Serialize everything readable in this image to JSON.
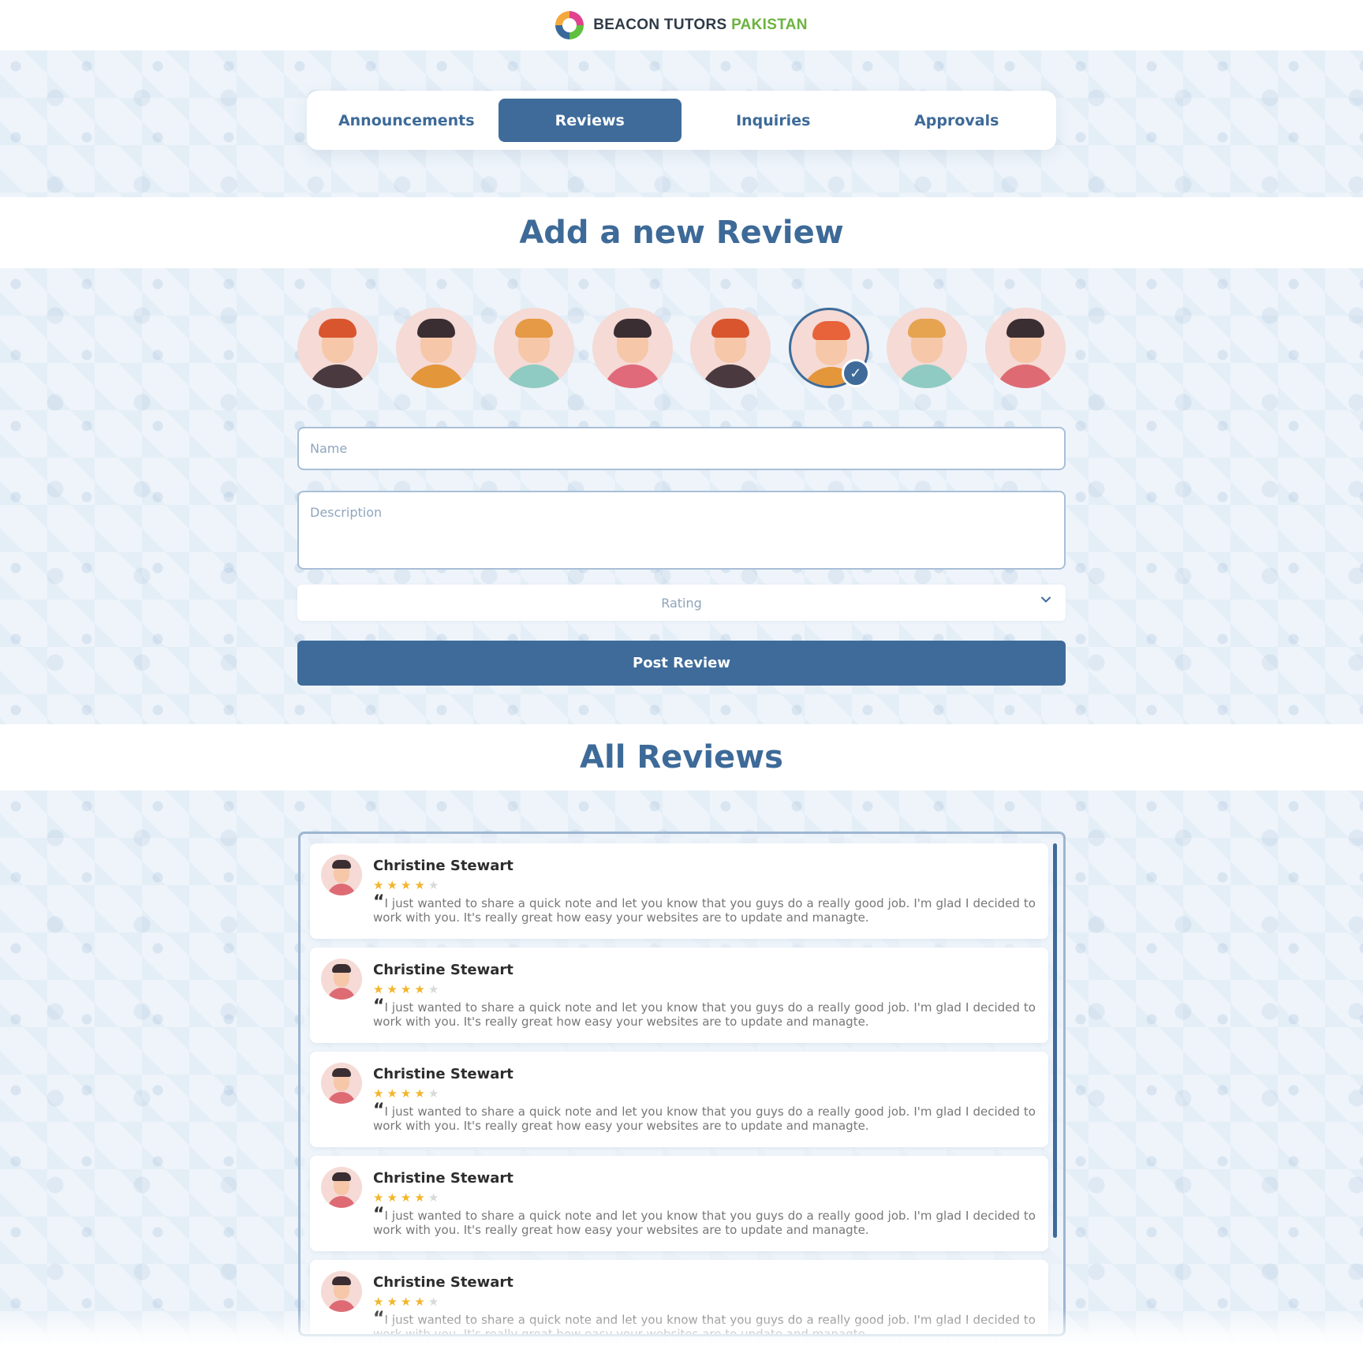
{
  "header": {
    "brand_main": "BEACON TUTORS",
    "brand_accent": "PAKISTAN",
    "logo_icon": "beacon-logo-icon"
  },
  "tabs": [
    {
      "label": "Announcements",
      "active": false
    },
    {
      "label": "Reviews",
      "active": true
    },
    {
      "label": "Inquiries",
      "active": false
    },
    {
      "label": "Approvals",
      "active": false
    }
  ],
  "form": {
    "title": "Add a new Review",
    "avatars": [
      {
        "hair": "#d8552e",
        "body": "#4a3a40",
        "selected": false
      },
      {
        "hair": "#3b2e33",
        "body": "#e3963a",
        "selected": false
      },
      {
        "hair": "#e69a45",
        "body": "#8fcbc2",
        "selected": false
      },
      {
        "hair": "#3b2e33",
        "body": "#e0697a",
        "selected": false
      },
      {
        "hair": "#d8552e",
        "body": "#4a3a40",
        "selected": false
      },
      {
        "hair": "#e8623a",
        "body": "#e3963a",
        "selected": true
      },
      {
        "hair": "#e6a451",
        "body": "#8fcbc2",
        "selected": false
      },
      {
        "hair": "#3b2e33",
        "body": "#de6b74",
        "selected": false
      }
    ],
    "name_placeholder": "Name",
    "description_placeholder": "Description",
    "rating_placeholder": "Rating",
    "submit_label": "Post Review"
  },
  "reviews": {
    "title": "All Reviews",
    "items": [
      {
        "name": "Christine Stewart",
        "rating": 4,
        "max_rating": 5,
        "text": "I just wanted to share a quick note and let you know that you guys do a really good job. I'm glad I decided to work with you. It's really great how easy your websites are to update and managte."
      },
      {
        "name": "Christine Stewart",
        "rating": 4,
        "max_rating": 5,
        "text": "I just wanted to share a quick note and let you know that you guys do a really good job. I'm glad I decided to work with you. It's really great how easy your websites are to update and managte."
      },
      {
        "name": "Christine Stewart",
        "rating": 4,
        "max_rating": 5,
        "text": "I just wanted to share a quick note and let you know that you guys do a really good job. I'm glad I decided to work with you. It's really great how easy your websites are to update and managte."
      },
      {
        "name": "Christine Stewart",
        "rating": 4,
        "max_rating": 5,
        "text": "I just wanted to share a quick note and let you know that you guys do a really good job. I'm glad I decided to work with you. It's really great how easy your websites are to update and managte."
      },
      {
        "name": "Christine Stewart",
        "rating": 4,
        "max_rating": 5,
        "text": "I just wanted to share a quick note and let you know that you guys do a really good job. I'm glad I decided to work with you. It's really great how easy your websites are to update and managte."
      }
    ]
  },
  "colors": {
    "primary": "#3e6b9a",
    "brand_green": "#6cb33f",
    "star": "#f3b52b"
  }
}
